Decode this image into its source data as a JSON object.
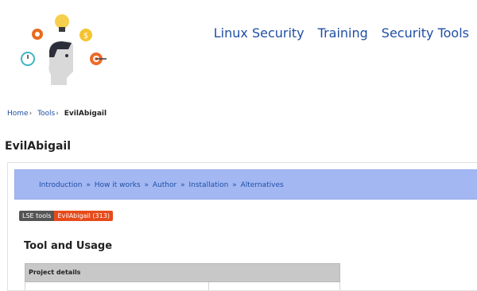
{
  "header": {
    "nav": [
      "Linux Security",
      "Training",
      "Security Tools"
    ],
    "logo_icon": "thinker-head-with-ideas-icon"
  },
  "breadcrumb": {
    "items": [
      "Home",
      "Tools"
    ],
    "current": "EvilAbigail"
  },
  "page": {
    "title": "EvilAbigail"
  },
  "toc": {
    "items": [
      "Introduction",
      "How it works",
      "Author",
      "Installation",
      "Alternatives"
    ],
    "separator": "»"
  },
  "badges": {
    "left": "LSE tools",
    "right": "EvilAbigail (313)"
  },
  "section": {
    "title": "Tool and Usage"
  },
  "table": {
    "header": "Project details"
  },
  "colors": {
    "link": "#1f4ea3",
    "toc_bg": "#a3b8f3",
    "badge_dark": "#555555",
    "badge_accent": "#e74a1a",
    "table_header_bg": "#c8c8c8"
  }
}
